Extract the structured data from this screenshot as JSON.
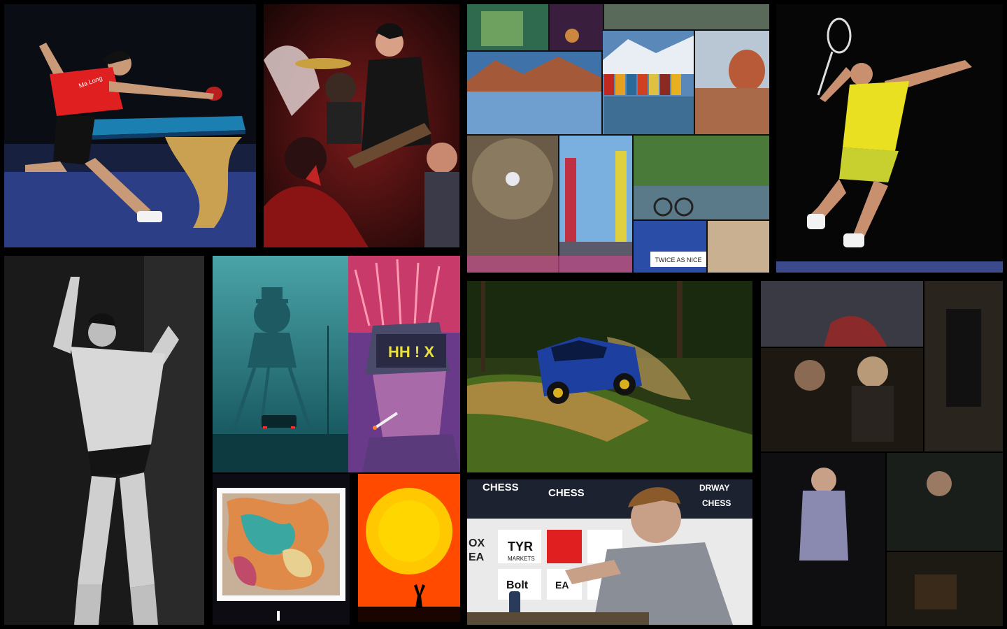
{
  "collage": {
    "background": "#000000",
    "tiles": [
      {
        "name": "table-tennis-photo",
        "subject": "table tennis player lunging at table",
        "shirt_text": "Ma Long",
        "accent": "#e02020"
      },
      {
        "name": "rock-band-photo",
        "subject": "band performing on red-lit stage",
        "accent": "#c81e1e"
      },
      {
        "name": "travel-collage-photo",
        "subject": "travel photo mosaic of cities and landscapes",
        "sign_text": "TWICE AS NICE"
      },
      {
        "name": "badminton-photo",
        "subject": "badminton player jumping smash",
        "accent": "#e8e020"
      },
      {
        "name": "bodybuilder-photo",
        "subject": "black and white bodybuilder pose"
      },
      {
        "name": "giant-robot-art",
        "subject": "teal illustration of giant walking robot"
      },
      {
        "name": "cyberpunk-face-art",
        "subject": "illustration of man with visor and cigarette",
        "visor_text": "HH ! X"
      },
      {
        "name": "fabric-sculpture-art",
        "subject": "crumpled colorful fabric installation"
      },
      {
        "name": "sun-silhouette-art",
        "subject": "figure raising arms under giant sun",
        "accent": "#ff9d00"
      },
      {
        "name": "rally-car-photo",
        "subject": "blue rally car sliding on dirt forest road",
        "accent": "#1d3fa0"
      },
      {
        "name": "movie-stills-collage",
        "subject": "grid of dark film stills"
      },
      {
        "name": "chess-player-photo",
        "subject": "chess player at board with sponsor wall",
        "sponsors": [
          "CHESS",
          "CHESS",
          "DRWAY",
          "CHESS",
          "OX",
          "EA",
          "TYR",
          "MARKETS",
          "Bolt",
          "EA"
        ]
      }
    ]
  }
}
